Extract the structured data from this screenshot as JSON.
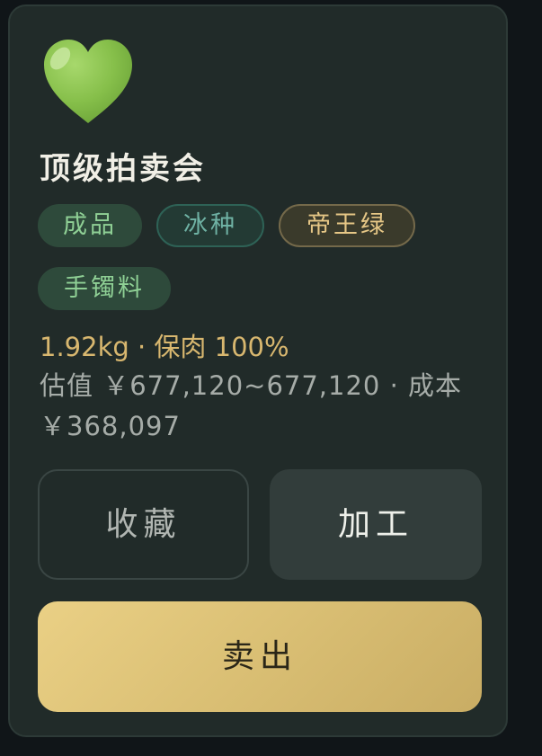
{
  "item": {
    "icon": "green-heart-icon",
    "title": "顶级拍卖会",
    "tags": [
      {
        "label": "成品",
        "style": "green"
      },
      {
        "label": "冰种",
        "style": "teal"
      },
      {
        "label": "帝王绿",
        "style": "gold"
      },
      {
        "label": "手镯料",
        "style": "green"
      }
    ],
    "weight_line": "1.92kg · 保肉 100%",
    "value_line": "估值 ￥677,120~677,120 · 成本 ￥368,097"
  },
  "actions": {
    "favorite_label": "收藏",
    "process_label": "加工",
    "sell_label": "卖出"
  },
  "colors": {
    "background": "#101518",
    "card": "#212b29",
    "title": "#f1efe6",
    "tag_green_text": "#8fd095",
    "tag_teal_text": "#6fb2a4",
    "tag_gold_text": "#e6c786",
    "weight_text": "#d8b76f",
    "value_text": "#a6aca8",
    "sell_button": "#e0c57a"
  }
}
